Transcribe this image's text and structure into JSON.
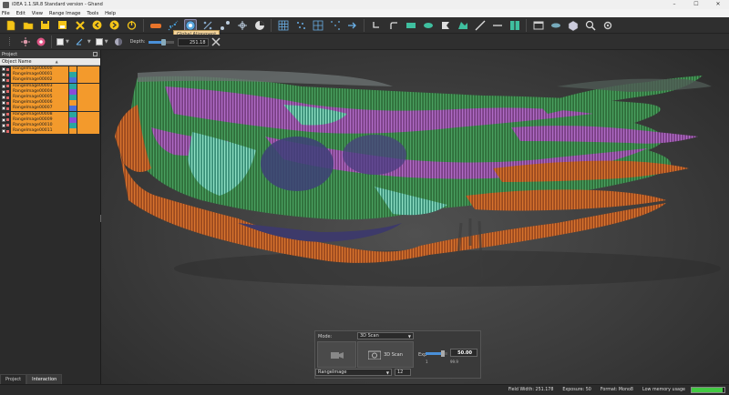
{
  "window": {
    "title": "iDEA 1.1.SR.8 Standard version - Ghand"
  },
  "window_controls": [
    "–",
    "☐",
    "✕"
  ],
  "menu": [
    "File",
    "Edit",
    "View",
    "Range Image",
    "Tools",
    "Help"
  ],
  "toolbar": {
    "tooltip": "Global Alignment"
  },
  "depth": {
    "label": "Depth:",
    "value": "251.18",
    "level_percent": 60
  },
  "project_panel": {
    "title": "Project",
    "column_header": "Object Name",
    "items": [
      "RangeImage00000",
      "RangeImage00001",
      "RangeImage00002",
      "RangeImage00003",
      "RangeImage00004",
      "RangeImage00005",
      "RangeImage00006",
      "RangeImage00007",
      "RangeImage00008",
      "RangeImage00009",
      "RangeImage00010",
      "RangeImage00011"
    ],
    "item_color": "#f39a2c",
    "swatch_colors": [
      "#f39a2c",
      "#2aa6a0",
      "#4b6fd8",
      "#2aa6a0",
      "#8a4bd8",
      "#2aa6a0",
      "#f39a2c",
      "#4b6fd8",
      "#2aa6a0",
      "#8a4bd8",
      "#2aa6a0",
      "#f39a2c"
    ]
  },
  "tabs": [
    "Project",
    "Interaction"
  ],
  "scan_panel": {
    "mode_label": "Mode:",
    "mode_value": "3D Scan",
    "scan_button_label": "3D Scan",
    "exp_label": "Exp",
    "exp_value": "50.00",
    "exp_min": "1",
    "exp_max": "99.9",
    "image_select": "RangeImage",
    "count_value": "12"
  },
  "status": {
    "field_width": "Field Width: 251.178",
    "exposure": "Exposure: 50",
    "format": "Format: Mono8",
    "memory": "Low memory usage",
    "memory_percent": 95
  }
}
